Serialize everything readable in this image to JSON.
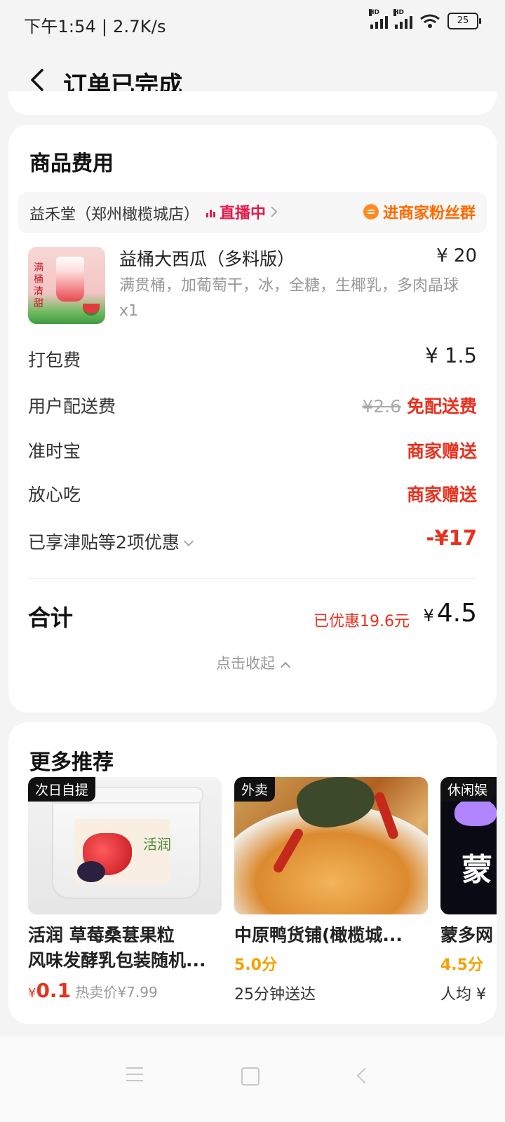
{
  "status_bar": {
    "left_text": "下午1:54 | 2.7K/s",
    "battery": "25",
    "signal_label": "HD"
  },
  "header": {
    "title": "订单已完成"
  },
  "fee_card": {
    "title": "商品费用",
    "store": {
      "name": "益禾堂（郑州橄榄城店）",
      "live_label": "直播中",
      "fan_group_label": "进商家粉丝群"
    },
    "product": {
      "image_text": "满桶清甜",
      "name": "益桶大西瓜（多料版）",
      "price": "¥ 20",
      "spec": "满贯桶，加葡萄干，冰，全糖，生椰乳，多肉晶球",
      "quantity": "x1"
    },
    "fees": [
      {
        "label": "打包费",
        "value": "¥ 1.5"
      },
      {
        "label": "用户配送费",
        "original": "¥2.6",
        "value": "免配送费"
      },
      {
        "label": "准时宝",
        "value": "商家赠送"
      },
      {
        "label": "放心吃",
        "value": "商家赠送"
      },
      {
        "label": "已享津贴等2项优惠",
        "value": "-¥17"
      }
    ],
    "total": {
      "label": "合计",
      "saved": "已优惠19.6元",
      "yen": "¥",
      "amount": "4.5"
    },
    "collapse_label": "点击收起"
  },
  "recommend": {
    "title": "更多推荐",
    "items": [
      {
        "tag": "次日自提",
        "image_brand": "活润",
        "title_line1": "活润 草莓桑葚果粒",
        "title_line2": "风味发酵乳包装随机...",
        "price_yen": "¥",
        "price_now": "0.1",
        "price_hot": "热卖价¥7.99"
      },
      {
        "tag": "外卖",
        "title_line1": "中原鸭货铺(橄榄城...",
        "score": "5.0分",
        "meta": "25分钟送达"
      },
      {
        "tag": "休闲娱",
        "image_text": "蒙",
        "title_line1": "蒙多网",
        "score": "4.5分",
        "meta": "人均 ¥"
      }
    ]
  },
  "colors": {
    "accent_red": "#e8321f",
    "live_pink": "#e8194a",
    "orange": "#ff6a00",
    "score_yellow": "#f4a200"
  }
}
